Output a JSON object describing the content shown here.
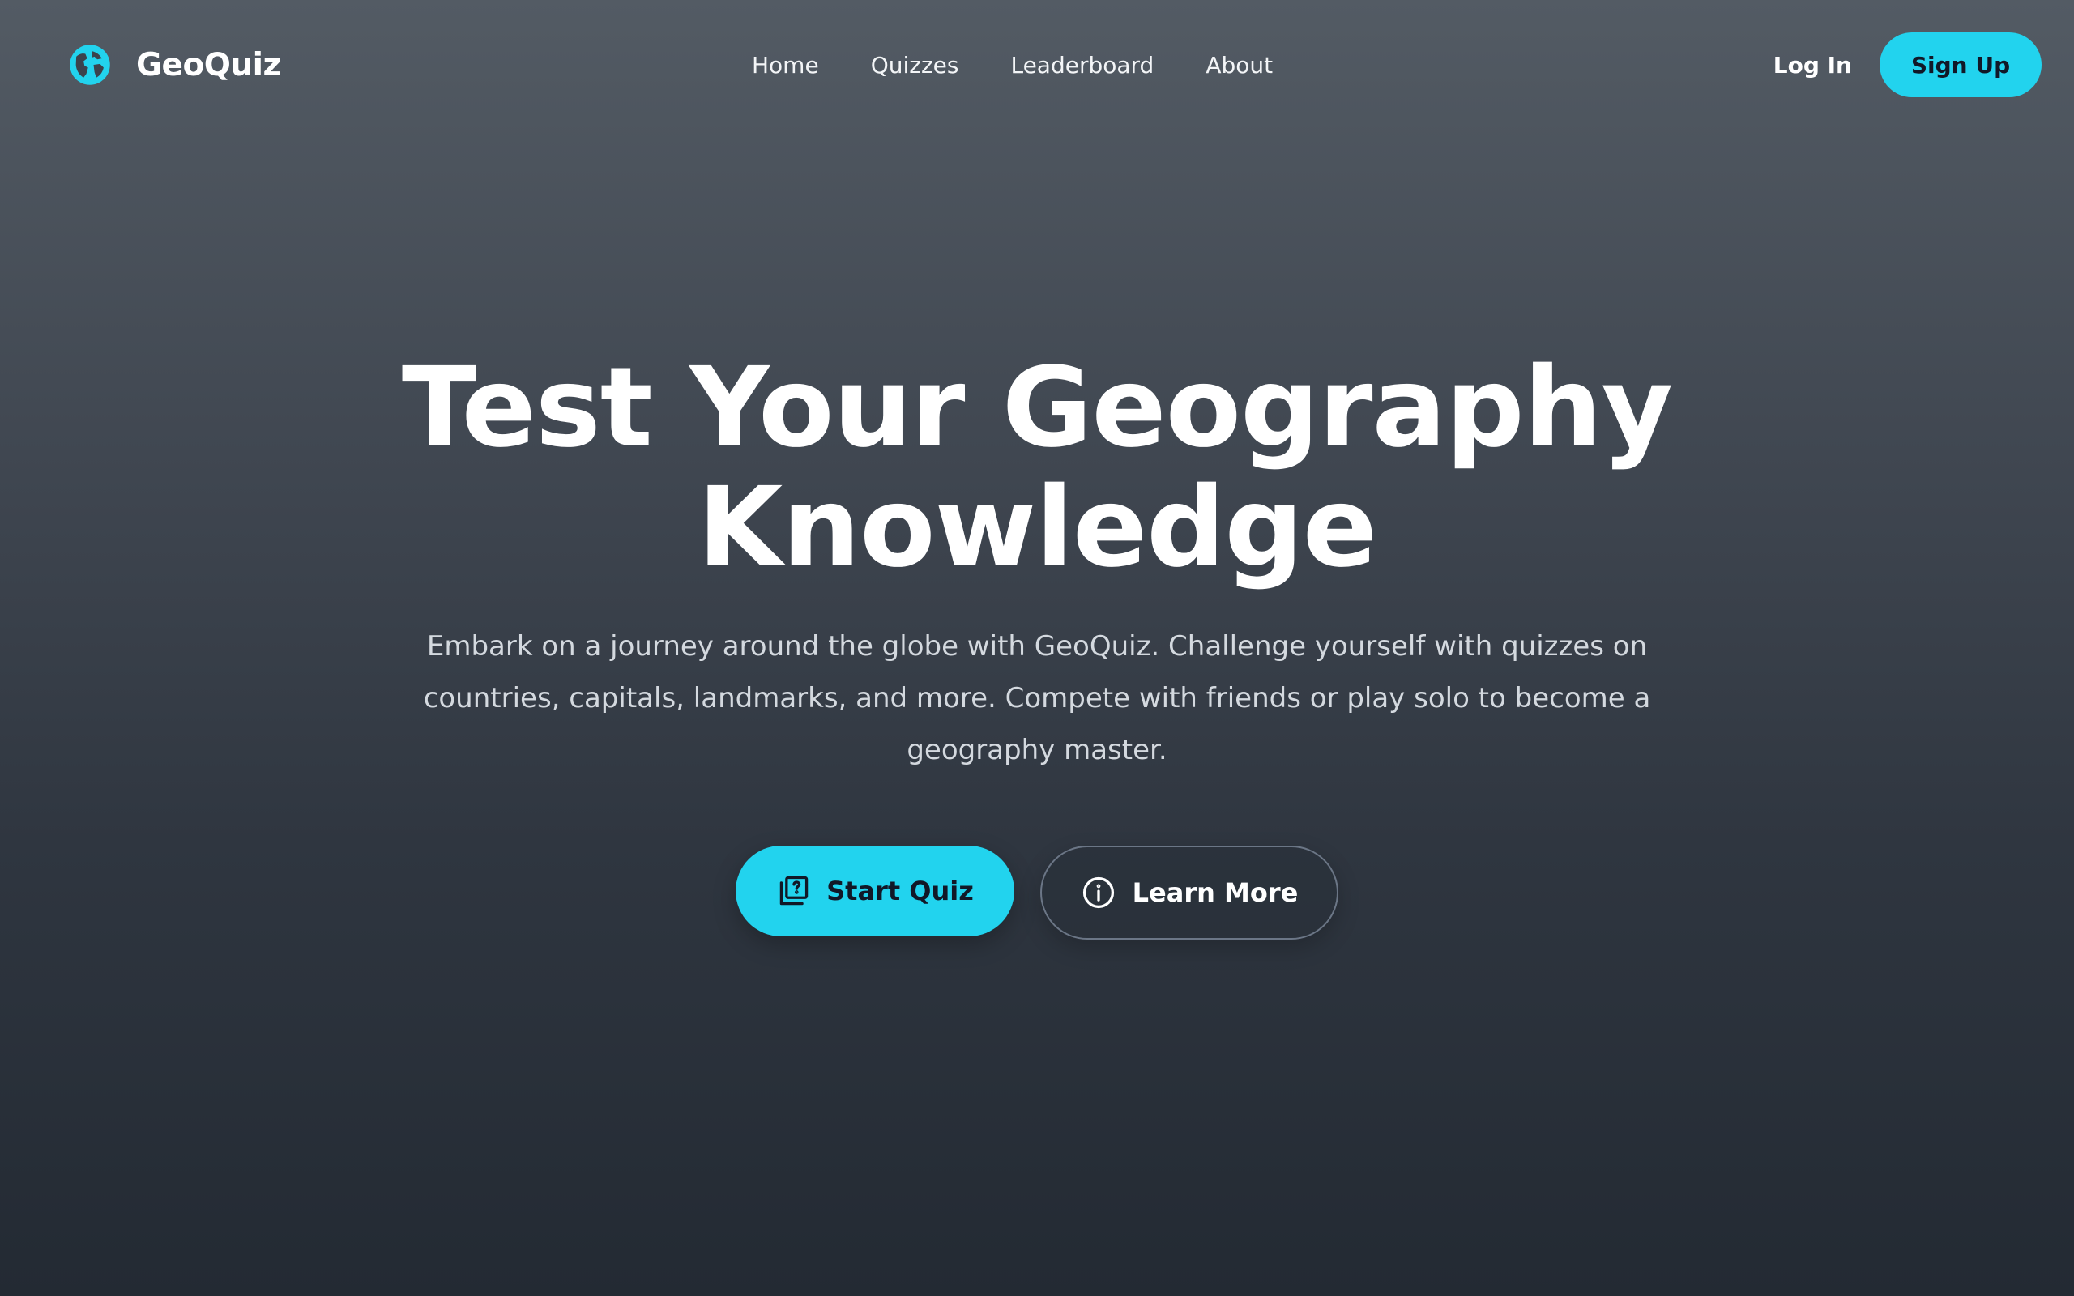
{
  "brand": {
    "name": "GeoQuiz",
    "icon": "globe-icon",
    "accent_color": "#22d3ee"
  },
  "nav": {
    "links": [
      "Home",
      "Quizzes",
      "Leaderboard",
      "About"
    ]
  },
  "auth": {
    "login_label": "Log In",
    "signup_label": "Sign Up"
  },
  "hero": {
    "title_line1": "Test Your Geography",
    "title_line2": "Knowledge",
    "subtitle": "Embark on a journey around the globe with GeoQuiz. Challenge yourself with quizzes on countries, capitals, landmarks, and more. Compete with friends or play solo to become a geography master.",
    "primary_cta": {
      "label": "Start Quiz",
      "icon": "quiz-icon"
    },
    "secondary_cta": {
      "label": "Learn More",
      "icon": "info-icon"
    }
  },
  "colors": {
    "background_top": "#535b64",
    "background_bottom": "#232a33",
    "accent": "#22d3ee",
    "button_text": "#111827"
  }
}
